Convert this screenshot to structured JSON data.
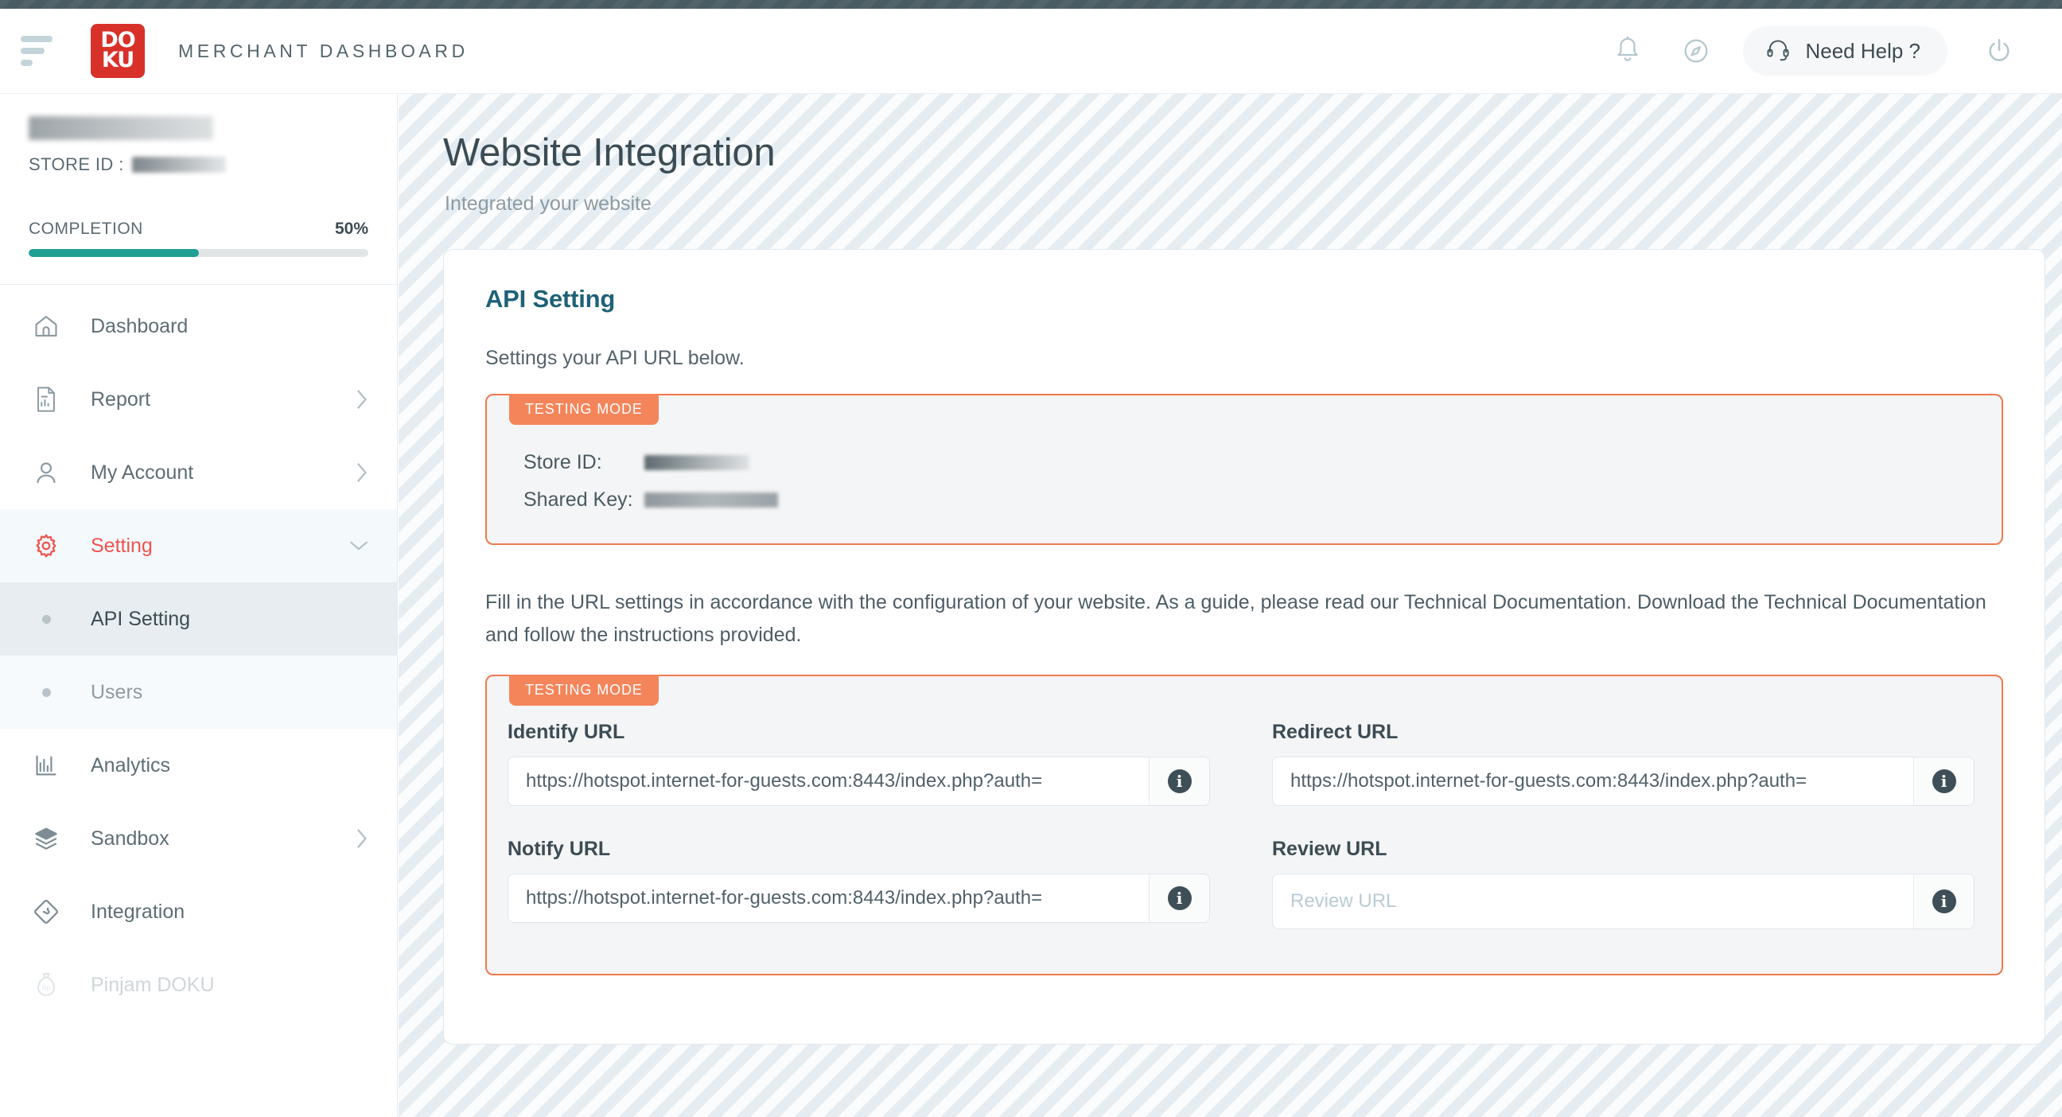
{
  "header": {
    "brand_title": "MERCHANT DASHBOARD",
    "logo_line1": "DO",
    "logo_line2": "KU",
    "notification_icon": "bell-icon",
    "explore_icon": "compass-icon",
    "help_label": "Need Help ?",
    "help_icon": "headset-icon",
    "power_icon": "power-icon"
  },
  "sidebar": {
    "account_name": "",
    "store_id_label": "STORE ID :",
    "store_id_value": "",
    "completion_label": "COMPLETION",
    "completion_percent": "50%",
    "completion_value": 50,
    "menu": [
      {
        "label": "Dashboard",
        "icon": "home-icon",
        "chevron": "",
        "state": "normal"
      },
      {
        "label": "Report",
        "icon": "report-icon",
        "chevron": "›",
        "state": "normal"
      },
      {
        "label": "My Account",
        "icon": "user-icon",
        "chevron": "›",
        "state": "normal"
      },
      {
        "label": "Setting",
        "icon": "gear-icon",
        "chevron": "⌄",
        "state": "active"
      }
    ],
    "submenu": [
      {
        "label": "API Setting",
        "state": "selected"
      },
      {
        "label": "Users",
        "state": "normal"
      }
    ],
    "menu_bottom": [
      {
        "label": "Analytics",
        "icon": "chart-icon",
        "chevron": "",
        "state": "normal"
      },
      {
        "label": "Sandbox",
        "icon": "layers-icon",
        "chevron": "›",
        "state": "normal"
      },
      {
        "label": "Integration",
        "icon": "puzzle-diamond-icon",
        "chevron": "",
        "state": "normal"
      },
      {
        "label": "Pinjam DOKU",
        "icon": "money-bag-icon",
        "chevron": "",
        "state": "disabled"
      }
    ]
  },
  "main": {
    "page_title": "Website Integration",
    "page_subtitle": "Integrated your website",
    "card_title": "API Setting",
    "card_description": "Settings your API URL below.",
    "credentials_panel": {
      "badge": "TESTING MODE",
      "store_id_label": "Store ID:",
      "store_id_value": "",
      "shared_key_label": "Shared Key:",
      "shared_key_value": ""
    },
    "instructions": "Fill in the URL settings in accordance with the configuration of your website. As a guide, please read our Technical Documentation. Download the Technical Documentation and follow the instructions provided.",
    "url_panel": {
      "badge": "TESTING MODE",
      "fields": [
        {
          "label": "Identify URL",
          "value": "https://hotspot.internet-for-guests.com:8443/index.php?auth=",
          "placeholder": "Identify URL",
          "info_icon": "info-icon"
        },
        {
          "label": "Redirect URL",
          "value": "https://hotspot.internet-for-guests.com:8443/index.php?auth=",
          "placeholder": "Redirect URL",
          "info_icon": "info-icon"
        },
        {
          "label": "Notify URL",
          "value": "https://hotspot.internet-for-guests.com:8443/index.php?auth=",
          "placeholder": "Notify URL",
          "info_icon": "info-icon"
        },
        {
          "label": "Review URL",
          "value": "",
          "placeholder": "Review URL",
          "info_icon": "info-icon"
        }
      ]
    }
  },
  "colors": {
    "brand_red": "#d8312a",
    "accent_red": "#ef5350",
    "teal": "#1fa093",
    "orange": "#f4855b",
    "title_blue": "#1f6177",
    "dark_slate": "#4a5c63"
  }
}
